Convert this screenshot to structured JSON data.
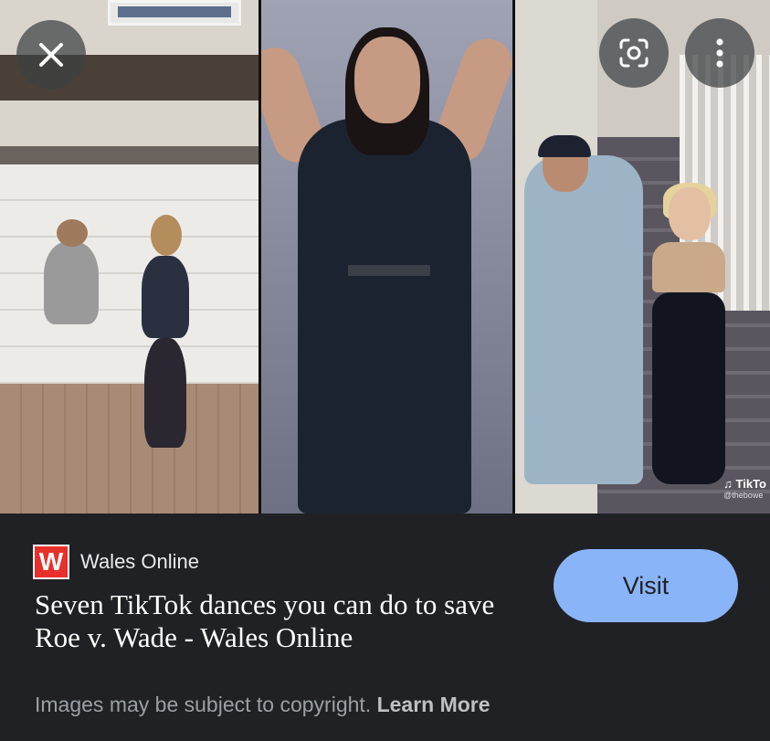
{
  "overlay": {
    "close_icon": "close-icon",
    "lens_icon": "google-lens-icon",
    "more_icon": "more-vert-icon"
  },
  "preview": {
    "watermark": "TikTo",
    "watermark_handle": "@thebowe"
  },
  "result": {
    "source_logo": "W",
    "source_name": "Wales Online",
    "title": "Seven TikTok dances you can do to save Roe v. Wade - Wales Online",
    "visit_label": "Visit"
  },
  "footer": {
    "notice": "Images may be subject to copyright.",
    "learn_more": "Learn More"
  },
  "colors": {
    "background": "#202124",
    "visit_button": "#8ab4f8",
    "logo_red": "#e8302a"
  }
}
